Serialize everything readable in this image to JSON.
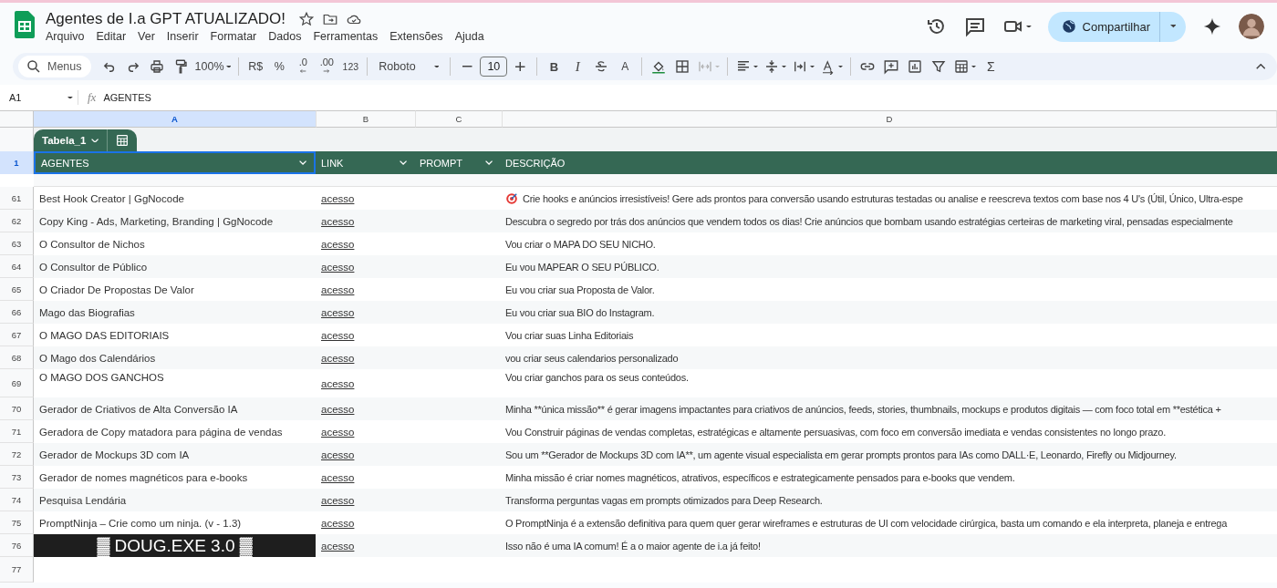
{
  "document": {
    "title": "Agentes de I.a GPT ATUALIZADO!"
  },
  "menu": [
    "Arquivo",
    "Editar",
    "Ver",
    "Inserir",
    "Formatar",
    "Dados",
    "Ferramentas",
    "Extensões",
    "Ajuda"
  ],
  "share": {
    "label": "Compartilhar"
  },
  "toolbar": {
    "search_placeholder": "Menus",
    "zoom": "100%",
    "currency": "R$",
    "percent": "%",
    "decrease_decimals": ".0",
    "increase_decimals": ".00",
    "number_format": "123",
    "font": "Roboto",
    "font_size": "10",
    "bold": "B",
    "italic": "I",
    "text_color": "A",
    "sum": "Σ"
  },
  "formula_bar": {
    "cell": "A1",
    "function_label": "fx",
    "value": "AGENTES"
  },
  "column_headers": [
    {
      "label": "A",
      "selected": true
    },
    {
      "label": "B",
      "selected": false
    },
    {
      "label": "C",
      "selected": false
    },
    {
      "label": "D",
      "selected": false
    }
  ],
  "table": {
    "name": "Tabela_1",
    "header_row": {
      "number": "1",
      "selected": true
    },
    "columns": [
      {
        "label": "AGENTES",
        "has_menu": true
      },
      {
        "label": "LINK",
        "has_menu": true
      },
      {
        "label": "PROMPT",
        "has_menu": true
      },
      {
        "label": "DESCRIÇÃO",
        "has_menu": false
      }
    ],
    "rows": [
      {
        "number": "61",
        "kind": "plain",
        "agent": "Best Hook Creator | GgNocode",
        "link": "acesso",
        "leading_icon": true,
        "description": "Crie hooks e anúncios irresistíveis! Gere ads prontos para conversão usando estruturas testadas ou analise e reescreva textos com base nos 4 U's (Útil, Único, Ultra-espe"
      },
      {
        "number": "62",
        "kind": "plain",
        "agent": "Copy King - Ads, Marketing, Branding | GgNocode",
        "link": "acesso",
        "description": "Descubra o segredo por trás dos anúncios que vendem todos os dias! Crie anúncios que bombam usando estratégias certeiras de marketing viral, pensadas especialmente"
      },
      {
        "number": "63",
        "kind": "plain",
        "agent": "O Consultor de Nichos",
        "link": "acesso",
        "description": "Vou criar o MAPA DO SEU NICHO."
      },
      {
        "number": "64",
        "kind": "plain",
        "agent": "O Consultor de Público",
        "link": "acesso",
        "description": "Eu vou MAPEAR O SEU PÚBLICO."
      },
      {
        "number": "65",
        "kind": "plain",
        "agent": "O Criador De Propostas De Valor",
        "link": "acesso",
        "description": "Eu vou criar sua Proposta de Valor."
      },
      {
        "number": "66",
        "kind": "plain",
        "agent": "Mago das Biografias",
        "link": "acesso",
        "description": "Eu vou criar sua BIO do Instagram."
      },
      {
        "number": "67",
        "kind": "plain",
        "agent": "O MAGO DAS EDITORIAIS",
        "link": "acesso",
        "description": "Vou criar suas Linha Editoriais"
      },
      {
        "number": "68",
        "kind": "plain",
        "agent": "O Mago dos Calendários",
        "link": "acesso",
        "description": "vou criar seus calendarios personalizado"
      },
      {
        "number": "69",
        "kind": "tall",
        "agent": "O MAGO DOS GANCHOS",
        "link": "acesso",
        "description": "Vou criar ganchos para os seus conteúdos."
      },
      {
        "number": "70",
        "kind": "plain",
        "agent": "Gerador de Criativos de Alta Conversão IA",
        "link": "acesso",
        "description": "Minha **única missão** é gerar imagens impactantes para criativos de anúncios, feeds, stories, thumbnails, mockups e produtos digitais — com foco total em **estética +"
      },
      {
        "number": "71",
        "kind": "plain",
        "agent": "Geradora de Copy matadora para página de vendas",
        "link": "acesso",
        "description": "Vou Construir páginas de vendas completas, estratégicas e altamente persuasivas, com foco em conversão imediata e vendas consistentes no longo prazo."
      },
      {
        "number": "72",
        "kind": "plain",
        "agent": "Gerador de Mockups 3D com IA",
        "link": "acesso",
        "description": "Sou um **Gerador de Mockups 3D com IA**, um agente visual especialista em gerar prompts prontos para IAs como DALL·E, Leonardo, Firefly ou Midjourney."
      },
      {
        "number": "73",
        "kind": "plain",
        "agent": "Gerador de nomes magnéticos para e-books",
        "link": "acesso",
        "description": "Minha missão é criar nomes magnéticos, atrativos, específicos e estrategicamente pensados para e-books que vendem."
      },
      {
        "number": "74",
        "kind": "plain",
        "agent": "Pesquisa Lendária",
        "link": "acesso",
        "description": "Transforma perguntas vagas em prompts otimizados para Deep Research."
      },
      {
        "number": "75",
        "kind": "plain",
        "agent": "PromptNinja – Crie como um ninja. (v - 1.3)",
        "link": "acesso",
        "description": "O PromptNinja é a extensão definitiva para quem quer gerar wireframes e estruturas de UI com velocidade cirúrgica, basta um comando e ela interpreta, planeja e entrega"
      },
      {
        "number": "76",
        "kind": "banner",
        "agent": "▓ DOUG.EXE 3.0 ▓",
        "link": "acesso",
        "description": "Isso não é uma IA comum! É a o maior agente de i.a já feito!"
      },
      {
        "number": "77",
        "kind": "empty"
      }
    ]
  }
}
